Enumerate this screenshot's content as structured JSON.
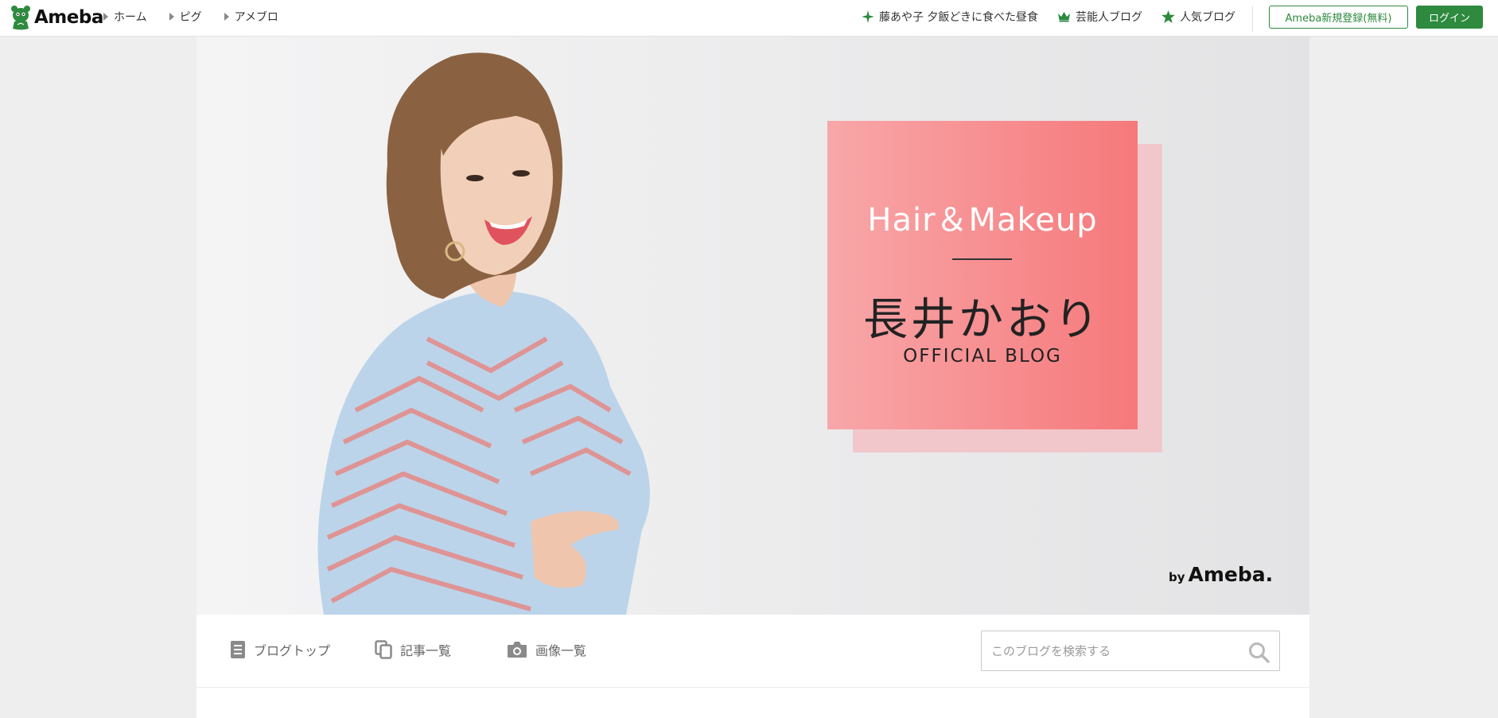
{
  "header": {
    "logo_text": "Ameba",
    "nav": [
      {
        "label": "ホーム"
      },
      {
        "label": "ピグ"
      },
      {
        "label": "アメブロ"
      }
    ],
    "right_links": [
      {
        "label": "藤あや子 夕飯どきに食べた昼食",
        "icon": "sparkle-icon"
      },
      {
        "label": "芸能人ブログ",
        "icon": "crown-icon"
      },
      {
        "label": "人気ブログ",
        "icon": "star-icon"
      }
    ],
    "register_label": "Ameba新規登録(無料)",
    "login_label": "ログイン"
  },
  "hero": {
    "title_en": "Hair＆Makeup",
    "title_jp": "長井かおり",
    "subtitle": "OFFICIAL BLOG",
    "by": "by",
    "brand": "Ameba."
  },
  "blog_nav": {
    "items": [
      {
        "label": "ブログトップ",
        "icon": "document-icon"
      },
      {
        "label": "記事一覧",
        "icon": "copy-icon"
      },
      {
        "label": "画像一覧",
        "icon": "camera-icon"
      }
    ],
    "search_placeholder": "このブログを検索する"
  },
  "colors": {
    "brand_green": "#2d8a3e",
    "card_pink": "#f6797b",
    "card_shadow": "#f2c7cb"
  }
}
